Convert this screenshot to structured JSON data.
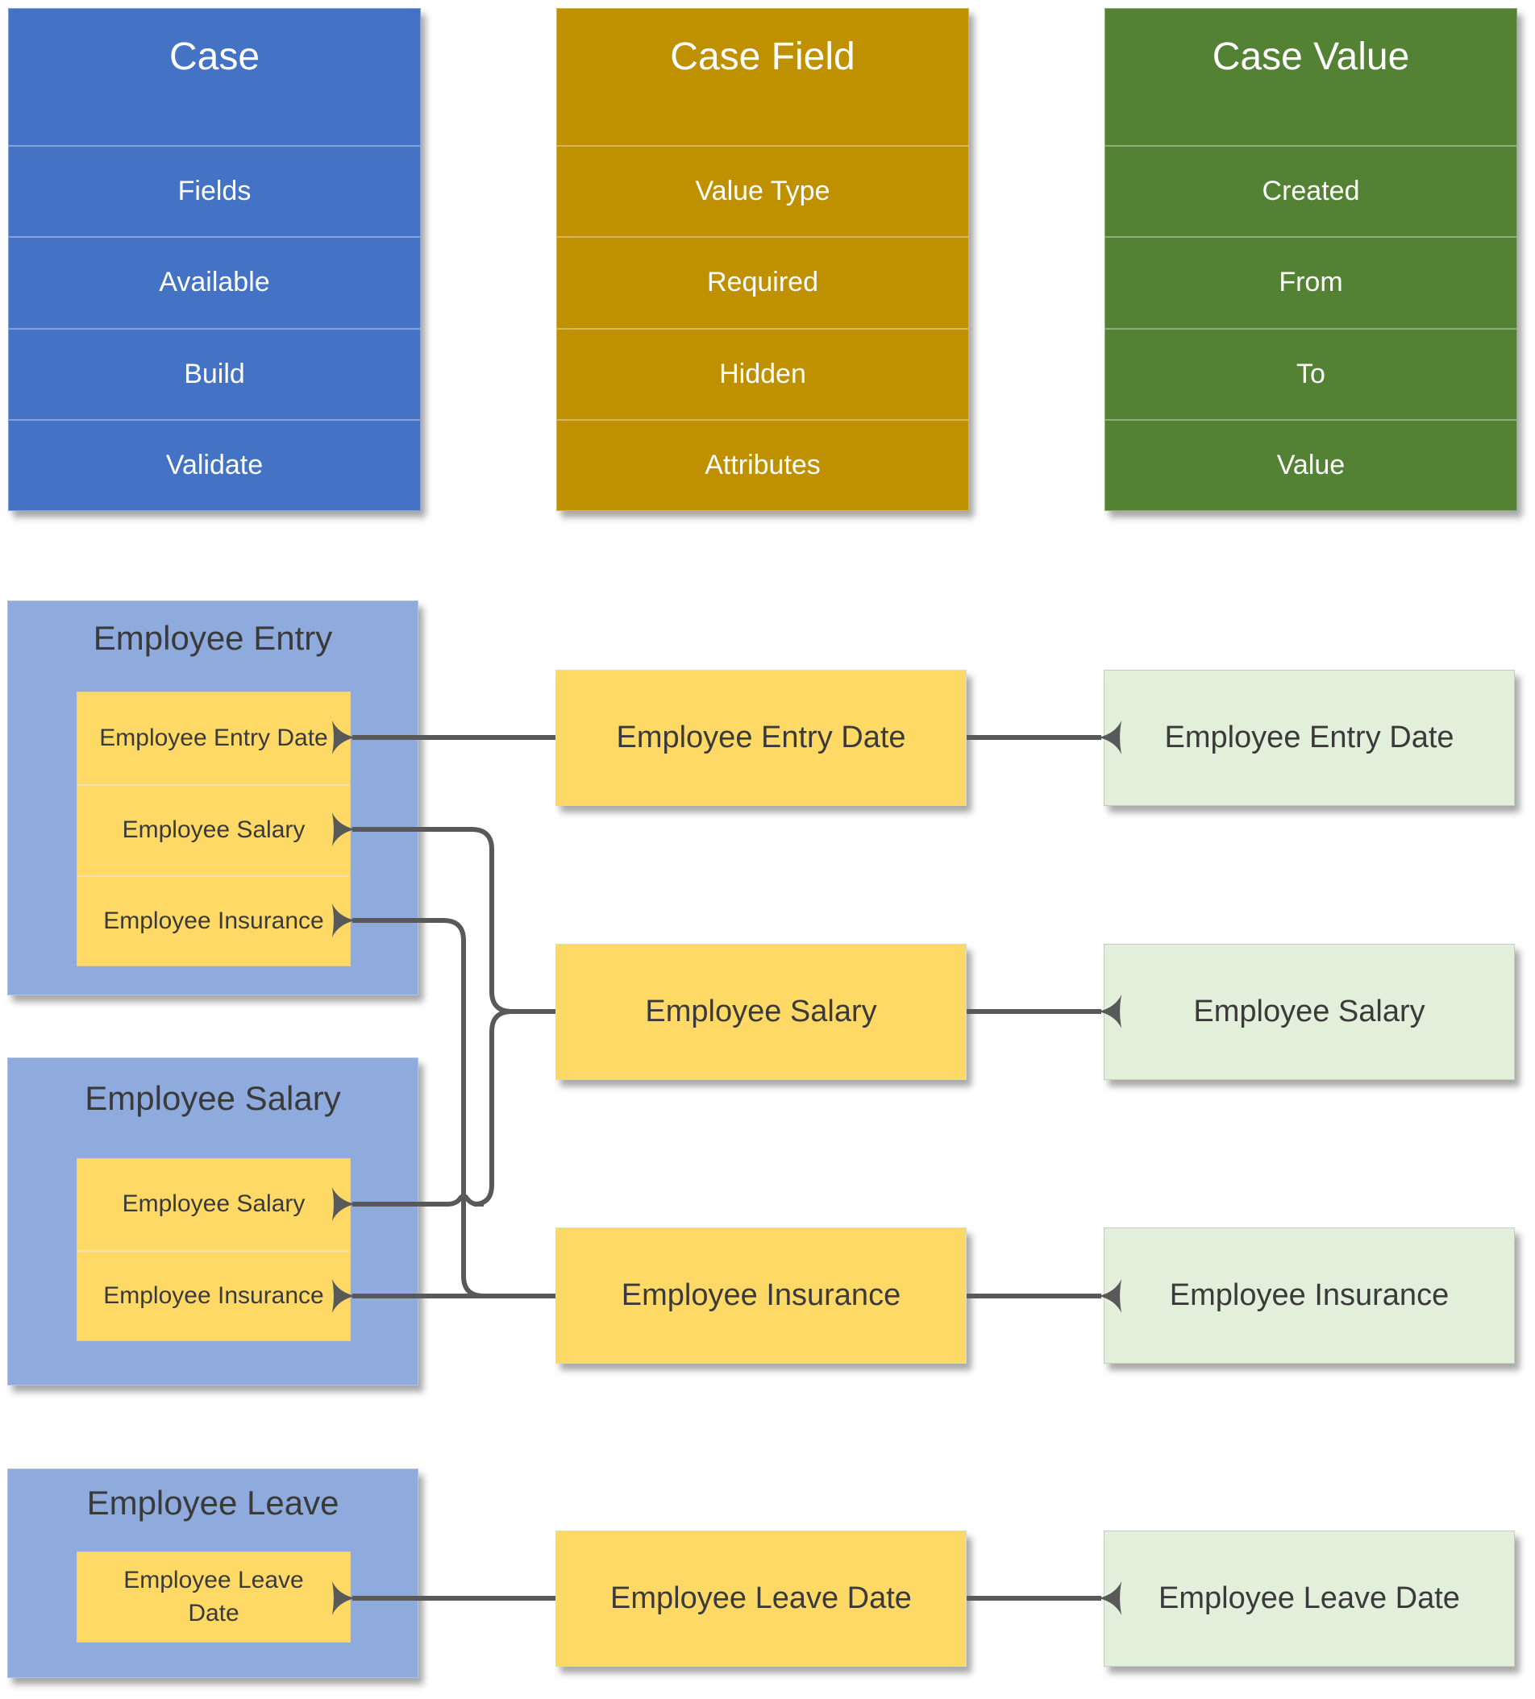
{
  "tables": [
    {
      "title": "Case",
      "color": "#4472c4",
      "rows": [
        "Fields",
        "Available",
        "Build",
        "Validate"
      ]
    },
    {
      "title": "Case Field",
      "color": "#bf9000",
      "rows": [
        "Value Type",
        "Required",
        "Hidden",
        "Attributes"
      ]
    },
    {
      "title": "Case Value",
      "color": "#548235",
      "rows": [
        "Created",
        "From",
        "To",
        "Value"
      ]
    }
  ],
  "cases": [
    {
      "title": "Employee Entry",
      "fields": [
        "Employee Entry Date",
        "Employee Salary",
        "Employee Insurance"
      ]
    },
    {
      "title": "Employee Salary",
      "fields": [
        "Employee Salary",
        "Employee Insurance"
      ]
    },
    {
      "title": "Employee Leave",
      "fields": [
        "Employee Leave Date"
      ]
    }
  ],
  "case_fields": [
    "Employee Entry Date",
    "Employee Salary",
    "Employee Insurance",
    "Employee Leave Date"
  ],
  "case_values": [
    "Employee Entry Date",
    "Employee Salary",
    "Employee Insurance",
    "Employee Leave Date"
  ],
  "colors": {
    "case_container": "#8faadc",
    "field_fill": "#ffd966",
    "value_fill": "#e2efda",
    "connector": "#595959"
  },
  "connections": [
    {
      "from": "Case Field: Employee Entry Date",
      "to": [
        "Employee Entry / Employee Entry Date",
        "Case Value: Employee Entry Date"
      ]
    },
    {
      "from": "Case Field: Employee Salary",
      "to": [
        "Employee Entry / Employee Salary",
        "Employee Salary / Employee Salary",
        "Case Value: Employee Salary"
      ]
    },
    {
      "from": "Case Field: Employee Insurance",
      "to": [
        "Employee Entry / Employee Insurance",
        "Employee Salary / Employee Insurance",
        "Case Value: Employee Insurance"
      ]
    },
    {
      "from": "Case Field: Employee Leave Date",
      "to": [
        "Employee Leave / Employee Leave Date",
        "Case Value: Employee Leave Date"
      ]
    }
  ]
}
